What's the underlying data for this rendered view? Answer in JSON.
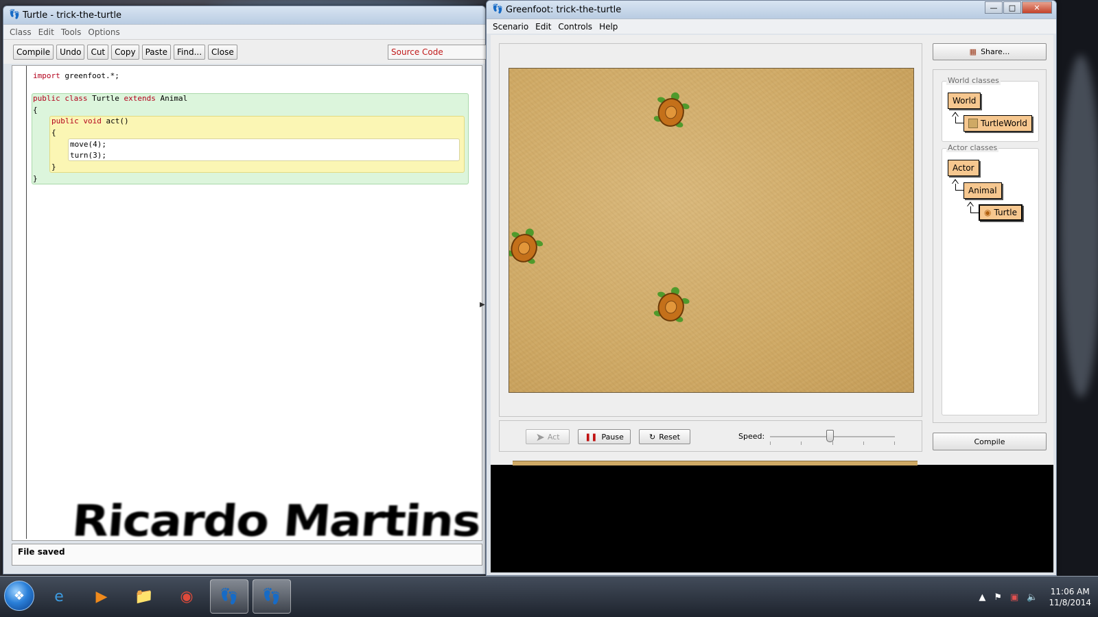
{
  "editor": {
    "title": "Turtle - trick-the-turtle",
    "menu": [
      "Class",
      "Edit",
      "Tools",
      "Options"
    ],
    "toolbar": [
      "Compile",
      "Undo",
      "Cut",
      "Copy",
      "Paste",
      "Find...",
      "Close"
    ],
    "view_selector": "Source Code",
    "code": {
      "line1_kw": "import",
      "line1_rest": " greenfoot.*;",
      "line2_kw1": "public",
      "line2_kw2": "class",
      "line2_name": " Turtle ",
      "line2_kw3": "extends",
      "line2_super": " Animal",
      "open_brace": "{",
      "close_brace": "}",
      "method_kw1": "public",
      "method_kw2": "void",
      "method_name": " act()",
      "stmt1": "move(4);",
      "stmt2": "turn(3);"
    },
    "status": "File saved",
    "signature": "Ricardo Martins"
  },
  "greenfoot": {
    "title": "Greenfoot: trick-the-turtle",
    "menu": [
      "Scenario",
      "Edit",
      "Controls",
      "Help"
    ],
    "share_label": "Share...",
    "act_label": "Act",
    "pause_label": "Pause",
    "reset_label": "Reset",
    "speed_label": "Speed:",
    "speed_value": 0.48,
    "compile_label": "Compile",
    "world_classes_label": "World classes",
    "actor_classes_label": "Actor classes",
    "world_classes": [
      "World",
      "TurtleWorld"
    ],
    "actor_classes": [
      "Actor",
      "Animal",
      "Turtle"
    ],
    "world_turtle_count": 3
  },
  "taskbar": {
    "time": "11:06 AM",
    "date": "11/8/2014"
  },
  "colors": {
    "class_box": "#f6c78f",
    "keyword": "#b3001b",
    "sand": "#cfa965"
  }
}
